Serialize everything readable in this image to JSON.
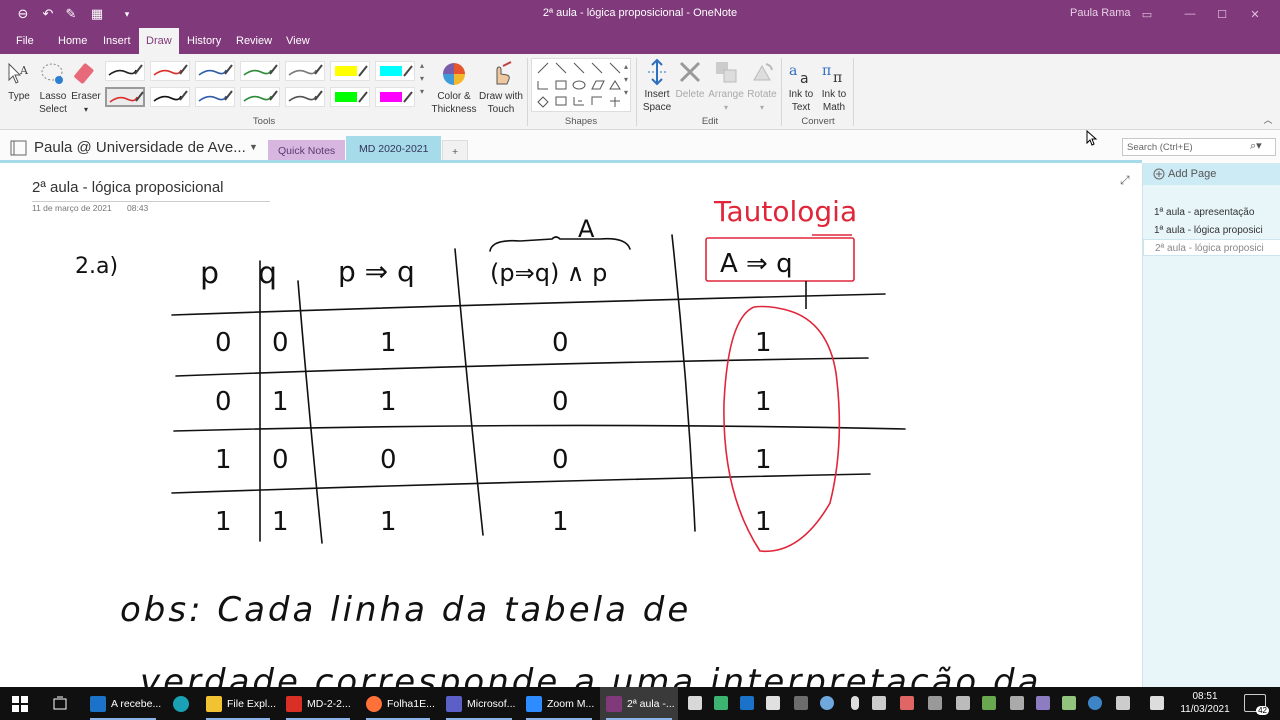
{
  "window": {
    "title": "2ª aula - lógica proposicional  -  OneNote",
    "user": "Paula Rama"
  },
  "menu": {
    "tabs": [
      "File",
      "Home",
      "Insert",
      "Draw",
      "History",
      "Review",
      "View"
    ],
    "active": "Draw"
  },
  "ribbon": {
    "tools": {
      "type": "Type",
      "lasso_l1": "Lasso",
      "lasso_l2": "Select",
      "eraser": "Eraser",
      "label": "Tools"
    },
    "color_thickness_l1": "Color &",
    "color_thickness_l2": "Thickness",
    "draw_touch_l1": "Draw with",
    "draw_touch_l2": "Touch",
    "shapes_label": "Shapes",
    "edit": {
      "insert_space_l1": "Insert",
      "insert_space_l2": "Space",
      "delete": "Delete",
      "arrange": "Arrange",
      "rotate": "Rotate",
      "label": "Edit"
    },
    "convert": {
      "ink_text_l1": "Ink to",
      "ink_text_l2": "Text",
      "ink_math_l1": "Ink to",
      "ink_math_l2": "Math",
      "label": "Convert"
    },
    "pen_colors": [
      "#222222",
      "#d9302a",
      "#2f5fa8",
      "#2e8b3a",
      "#7a7a7a",
      "#ffff00",
      "#00ffff",
      "#d9302a",
      "#111111",
      "#2f5fa8",
      "#2e8b3a",
      "#555555",
      "#00ff00",
      "#ff00ff"
    ]
  },
  "notebook": {
    "name": "Paula @ Universidade de Ave...",
    "sections": [
      "Quick Notes",
      "MD 2020-2021"
    ],
    "active_section": "MD 2020-2021",
    "add_section": "+",
    "search_placeholder": "Search (Ctrl+E)"
  },
  "page": {
    "title": "2ª aula - lógica proposicional",
    "date": "11 de março de 2021",
    "time": "08:43"
  },
  "pages_pane": {
    "add_page": "Add Page",
    "items": [
      "1ª aula - apresentação",
      "1ª aula - lógica proposici",
      "2ª aula - lógica proposici"
    ],
    "selected_index": 2
  },
  "handwriting": {
    "exercise": "2.a)",
    "headers": [
      "p",
      "q",
      "p ⇒ q",
      "(p⇒q) ∧ p"
    ],
    "brace_label": "A",
    "red_label": "Tautologia",
    "red_formula": "A ⇒ q",
    "rows": [
      [
        "0",
        "0",
        "1",
        "0",
        "1"
      ],
      [
        "0",
        "1",
        "1",
        "0",
        "1"
      ],
      [
        "1",
        "0",
        "0",
        "0",
        "1"
      ],
      [
        "1",
        "1",
        "1",
        "1",
        "1"
      ]
    ],
    "note_line1": "obs: Cada linha da tabela de",
    "note_line2": "verdade corresponde a uma interpretação da"
  },
  "taskbar": {
    "apps": [
      "A recebe...",
      "",
      "File Expl...",
      "MD-2-2...",
      "Folha1E...",
      "Microsof...",
      "Zoom M...",
      "2ª aula -..."
    ],
    "active_index": 7,
    "time": "08:51",
    "date": "11/03/2021",
    "notifications": "42"
  }
}
